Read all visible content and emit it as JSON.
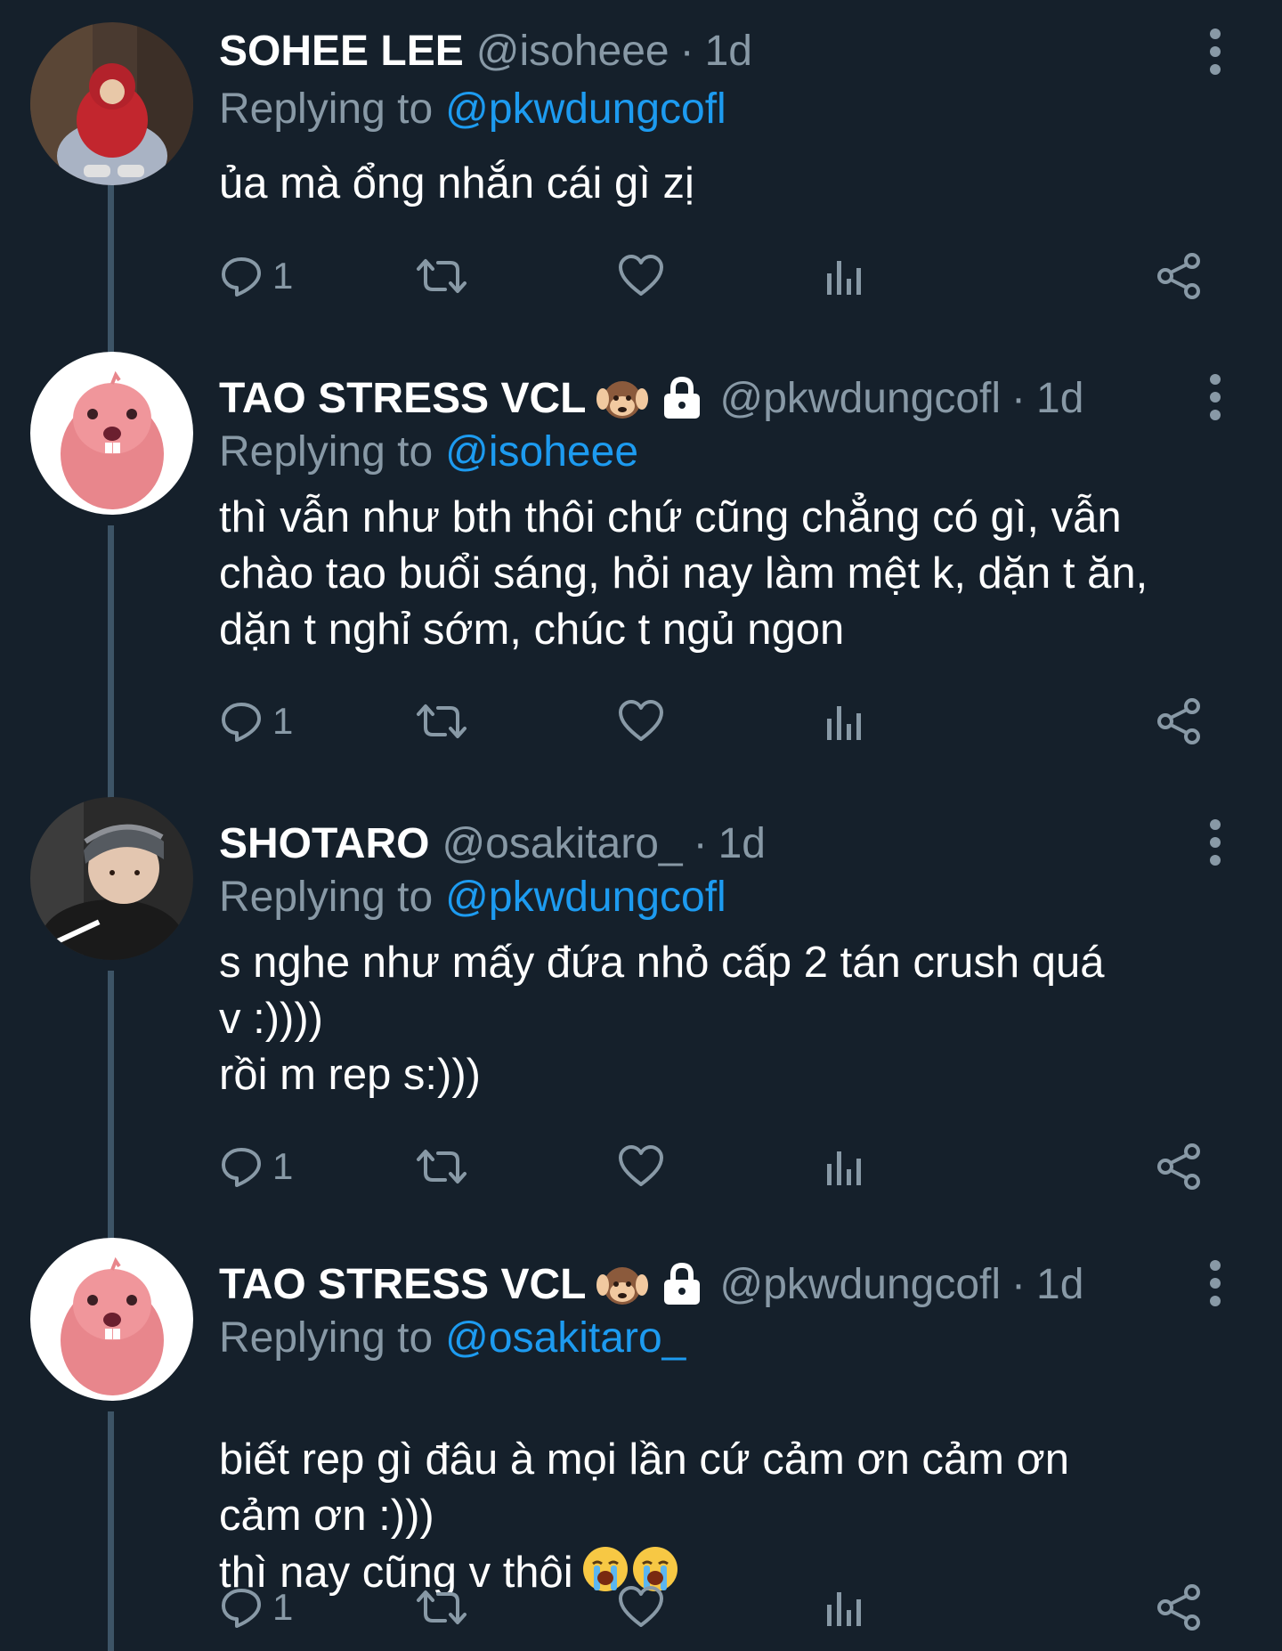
{
  "colors": {
    "background": "#15202b",
    "text_primary": "#ffffff",
    "text_secondary": "#8899a6",
    "link": "#1d9bf0",
    "thread_line": "#3d5466"
  },
  "tweets": [
    {
      "display_name": "SOHEE LEE",
      "handle": "@isoheee",
      "separator": "·",
      "time": "1d",
      "replying_prefix": "Replying to",
      "replying_to": "@pkwdungcofl",
      "text": "ủa mà ổng nhắn cái gì zị",
      "reply_count": "1",
      "avatar": "red-hoodie-person"
    },
    {
      "display_name": "TAO STRESS VCL",
      "name_emoji": "hear-no-evil-monkey-icon",
      "protected_icon": "lock-icon",
      "handle": "@pkwdungcofl",
      "separator": "·",
      "time": "1d",
      "replying_prefix": "Replying to",
      "replying_to": "@isoheee",
      "text": "thì vẫn như bth thôi chứ cũng chẳng có gì, vẫn\nchào tao buổi sáng, hỏi nay làm mệt k, dặn t ăn,\ndặn t nghỉ sớm, chúc t ngủ ngon",
      "reply_count": "1",
      "avatar": "pink-beaver-character"
    },
    {
      "display_name": "SHOTARO",
      "handle": "@osakitaro_",
      "separator": "·",
      "time": "1d",
      "replying_prefix": "Replying to",
      "replying_to": "@pkwdungcofl",
      "text": "s nghe như mấy đứa nhỏ cấp 2 tán crush quá\nv :))))\nrồi m rep s:)))",
      "reply_count": "1",
      "avatar": "person-with-cap"
    },
    {
      "display_name": "TAO STRESS VCL",
      "name_emoji": "hear-no-evil-monkey-icon",
      "protected_icon": "lock-icon",
      "handle": "@pkwdungcofl",
      "separator": "·",
      "time": "1d",
      "replying_prefix": "Replying to",
      "replying_to": "@osakitaro_",
      "text_line1": "biết rep gì đâu à mọi lần cứ cảm ơn cảm ơn\ncảm ơn :)))",
      "text_line2": "thì nay cũng v thôi",
      "text_emoji": "loudly-crying-face-icon",
      "reply_count": "1",
      "avatar": "pink-beaver-character"
    }
  ]
}
